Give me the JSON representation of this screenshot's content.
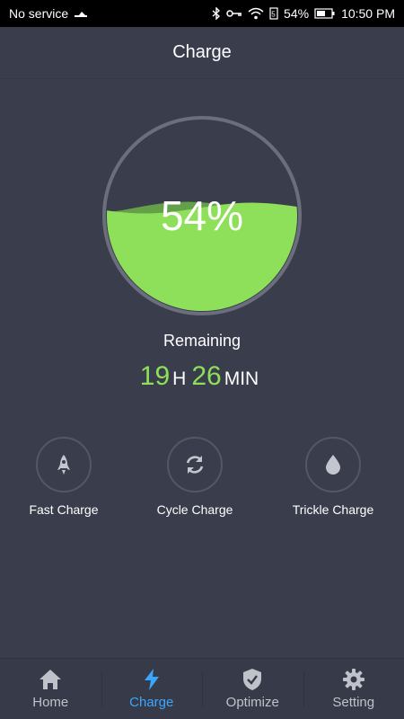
{
  "status_bar": {
    "carrier": "No service",
    "battery_percent": "54%",
    "time": "10:50 PM"
  },
  "header": {
    "title": "Charge"
  },
  "battery": {
    "percent_text": "54%",
    "level": 0.54,
    "fill_color": "#8ee05a",
    "remaining_label": "Remaining",
    "hours": "19",
    "hours_unit": "H",
    "minutes": "26",
    "minutes_unit": "MIN"
  },
  "modes": [
    {
      "label": "Fast Charge",
      "icon": "rocket-icon"
    },
    {
      "label": "Cycle Charge",
      "icon": "cycle-icon"
    },
    {
      "label": "Trickle Charge",
      "icon": "drop-icon"
    }
  ],
  "nav": {
    "active_color": "#3aa7ff",
    "items": [
      {
        "label": "Home",
        "icon": "home-icon"
      },
      {
        "label": "Charge",
        "icon": "bolt-icon"
      },
      {
        "label": "Optimize",
        "icon": "shield-icon"
      },
      {
        "label": "Setting",
        "icon": "gear-icon"
      }
    ]
  }
}
